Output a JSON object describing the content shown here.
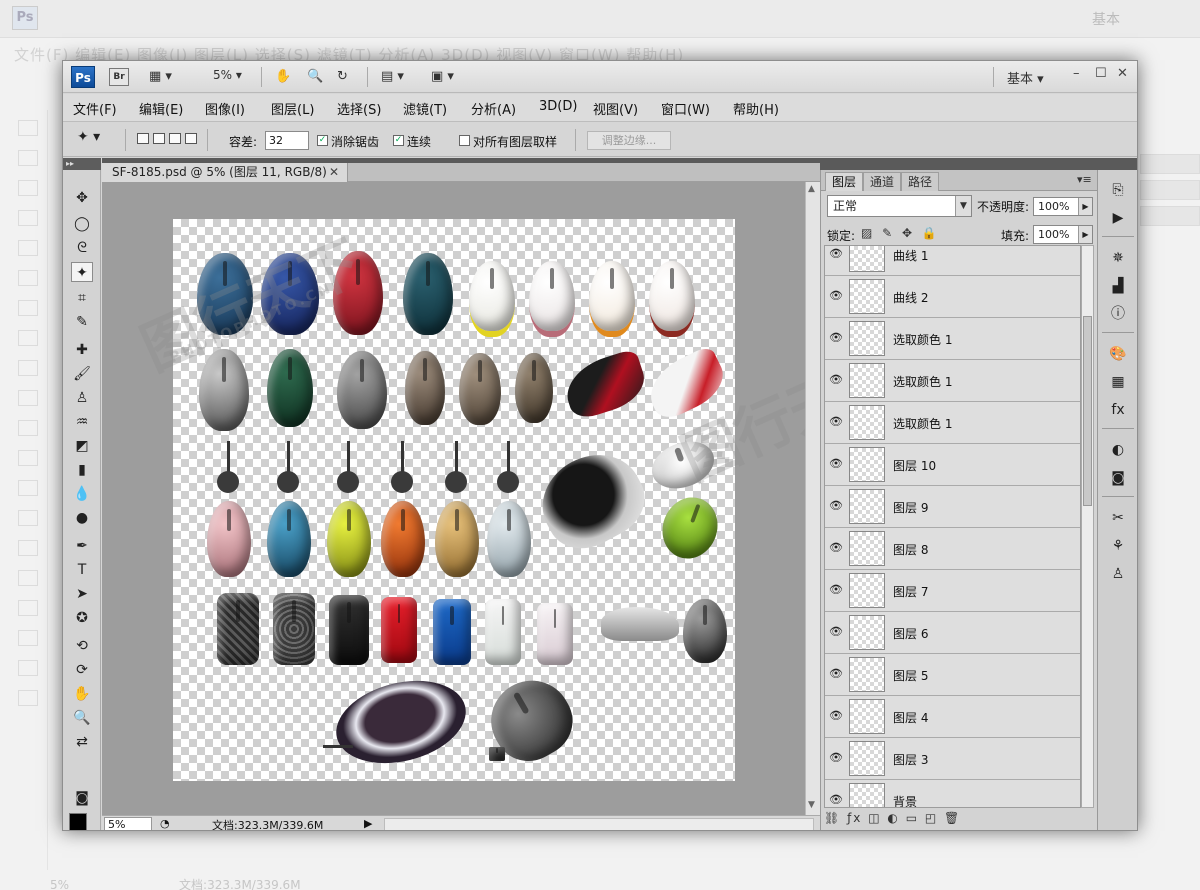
{
  "app": {
    "logo": "Ps",
    "bridge": "Br",
    "zoom": "5%",
    "workspace": "基本"
  },
  "menu": [
    "文件(F)",
    "编辑(E)",
    "图像(I)",
    "图层(L)",
    "选择(S)",
    "滤镜(T)",
    "分析(A)",
    "3D(D)",
    "视图(V)",
    "窗口(W)",
    "帮助(H)"
  ],
  "options": {
    "tolerance_label": "容差:",
    "tolerance_value": "32",
    "antialias_label": "消除锯齿",
    "contiguous_label": "连续",
    "sample_all_label": "对所有图层取样",
    "refine_label": "调整边缘...",
    "antialias_checked": true,
    "contiguous_checked": true,
    "sample_all_checked": false
  },
  "document": {
    "tab": "SF-8185.psd @ 5% (图层 11, RGB/8)",
    "zoom": "5%",
    "info": "文档:323.3M/339.6M"
  },
  "layers_panel": {
    "tabs": [
      "图层",
      "通道",
      "路径"
    ],
    "blend_mode": "正常",
    "opacity_label": "不透明度:",
    "opacity": "100%",
    "lock_label": "锁定:",
    "fill_label": "填充:",
    "fill": "100%",
    "layers": [
      "曲线 1",
      "曲线 2",
      "选取颜色 1",
      "选取颜色 1",
      "选取颜色 1",
      "图层 10",
      "图层 9",
      "图层 8",
      "图层 7",
      "图层 6",
      "图层 5",
      "图层 4",
      "图层 3",
      "背景"
    ]
  },
  "background": {
    "menu": "文件(F)  编辑(E)  图像(I)  图层(L)  选择(S)  滤镜(T)  分析(A)  3D(D)  视图(V)  窗口(W)  帮助(H)",
    "info": "文档:323.3M/339.6M",
    "zoom": "5%"
  },
  "watermark": {
    "text": "图行天下",
    "sub": "PHOTOPHOTO.CN"
  },
  "colors": {
    "accent": "#1a5fb4",
    "canvas_bg": "#9d9d9d"
  }
}
